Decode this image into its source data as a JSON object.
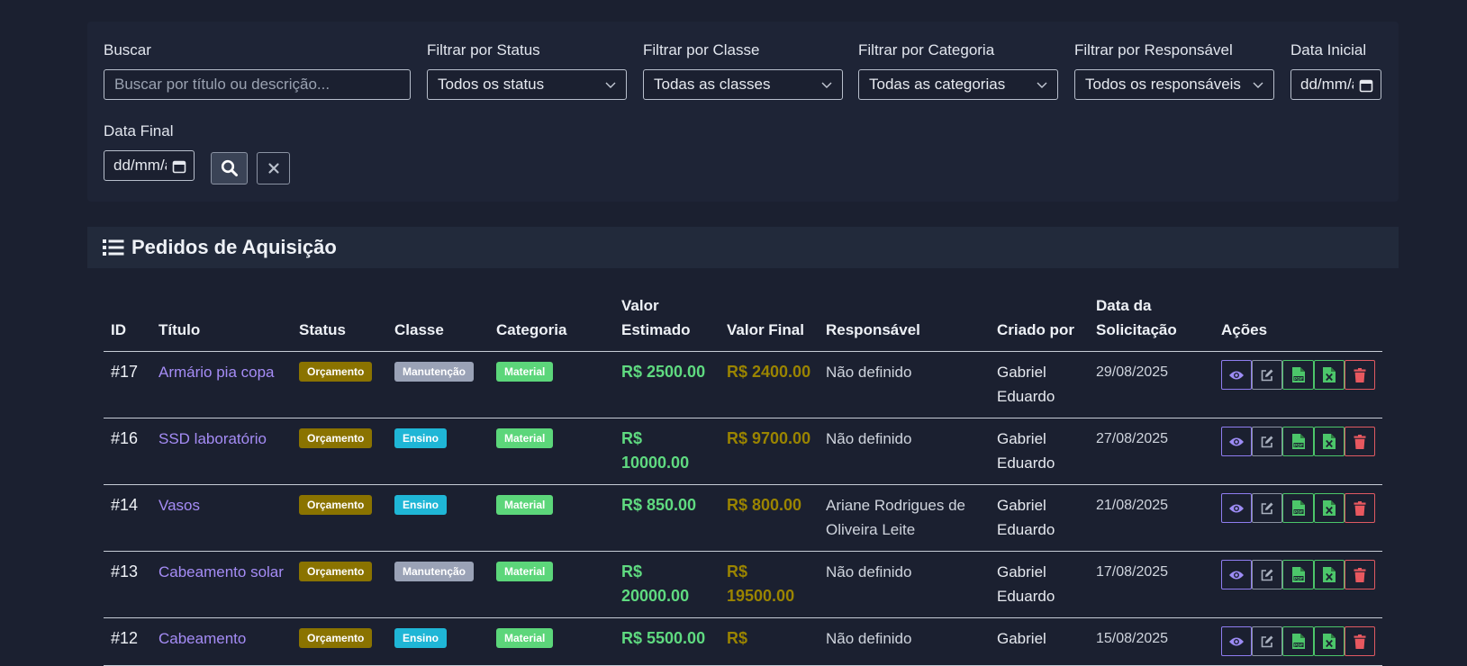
{
  "filters": {
    "search": {
      "label": "Buscar",
      "placeholder": "Buscar por título ou descrição..."
    },
    "status": {
      "label": "Filtrar por Status",
      "value": "Todos os status"
    },
    "classe": {
      "label": "Filtrar por Classe",
      "value": "Todas as classes"
    },
    "categoria": {
      "label": "Filtrar por Categoria",
      "value": "Todas as categorias"
    },
    "responsavel": {
      "label": "Filtrar por Responsável",
      "value": "Todos os responsáveis"
    },
    "data_inicial": {
      "label": "Data Inicial",
      "value": "dd/mm/aaaa"
    },
    "data_final": {
      "label": "Data Final",
      "value": "dd/mm/aaaa"
    }
  },
  "card": {
    "title": "Pedidos de Aquisição"
  },
  "table": {
    "headers": {
      "id": "ID",
      "titulo": "Título",
      "status": "Status",
      "classe": "Classe",
      "categoria": "Categoria",
      "valor_estimado_1": "Valor",
      "valor_estimado_2": "Estimado",
      "valor_final": "Valor Final",
      "responsavel": "Responsável",
      "criado_por": "Criado por",
      "data_1": "Data da",
      "data_2": "Solicitação",
      "acoes": "Ações"
    },
    "rows": [
      {
        "id": "#17",
        "titulo": "Armário pia copa",
        "status": "Orçamento",
        "classe": "Manutenção",
        "categoria": "Material",
        "valor_estimado": "R$ 2500.00",
        "valor_final": "R$ 2400.00",
        "responsavel": "Não definido",
        "criado_por": "Gabriel Eduardo",
        "data": "29/08/2025"
      },
      {
        "id": "#16",
        "titulo": "SSD laboratório",
        "status": "Orçamento",
        "classe": "Ensino",
        "categoria": "Material",
        "valor_estimado": "R$ 10000.00",
        "valor_final": "R$ 9700.00",
        "responsavel": "Não definido",
        "criado_por": "Gabriel Eduardo",
        "data": "27/08/2025"
      },
      {
        "id": "#14",
        "titulo": "Vasos",
        "status": "Orçamento",
        "classe": "Ensino",
        "categoria": "Material",
        "valor_estimado": "R$ 850.00",
        "valor_final": "R$ 800.00",
        "responsavel": "Ariane Rodrigues de Oliveira Leite",
        "criado_por": "Gabriel Eduardo",
        "data": "21/08/2025"
      },
      {
        "id": "#13",
        "titulo": "Cabeamento solar",
        "status": "Orçamento",
        "classe": "Manutenção",
        "categoria": "Material",
        "valor_estimado": "R$ 20000.00",
        "valor_final": "R$ 19500.00",
        "responsavel": "Não definido",
        "criado_por": "Gabriel Eduardo",
        "data": "17/08/2025"
      },
      {
        "id": "#12",
        "titulo": "Cabeamento",
        "status": "Orçamento",
        "classe": "Ensino",
        "categoria": "Material",
        "valor_estimado": "R$ 5500.00",
        "valor_final": "R$",
        "responsavel": "Não definido",
        "criado_por": "Gabriel",
        "data": "15/08/2025"
      }
    ]
  },
  "icons": {
    "list": "list-icon",
    "search": "search-icon",
    "clear": "close-icon",
    "view": "eye-icon",
    "edit": "edit-icon",
    "pdf": "file-pdf-icon",
    "excel": "file-excel-icon",
    "delete": "trash-icon"
  },
  "colors": {
    "background": "#1b2030",
    "panel": "#1e2436",
    "header": "#222a3b",
    "link": "#a58cf5",
    "valor_estimado": "#5fda80",
    "valor_final": "#9a8400",
    "badge_orcamento": "#8a7300",
    "badge_manutencao": "#9aa2b6",
    "badge_ensino": "#1fb6d6",
    "badge_material": "#5cd67a"
  }
}
